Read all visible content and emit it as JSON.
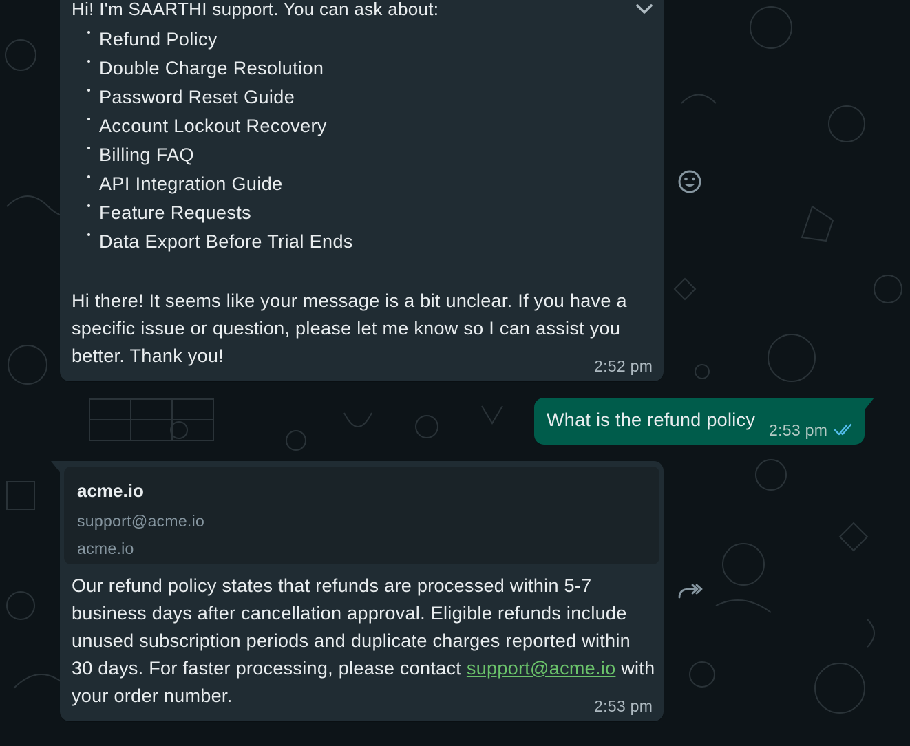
{
  "colors": {
    "incoming_bubble": "#202c33",
    "outgoing_bubble": "#005c4b",
    "timestamp": "#aebac1",
    "read_ticks": "#53bdeb",
    "link": "#6bc36b"
  },
  "messages": {
    "bot_intro": {
      "greeting": "Hi! I'm SAARTHI support. You can ask about:",
      "topics": [
        "Refund Policy",
        "Double Charge Resolution",
        "Password Reset Guide",
        "Account Lockout Recovery",
        "Billing FAQ",
        "API Integration Guide",
        "Feature Requests",
        "Data Export Before Trial Ends"
      ],
      "reply": "Hi there! It seems like your message is a bit unclear. If you have a specific issue or question, please let me know so I can assist you better. Thank you!",
      "time": "2:52 pm",
      "menu_icon": "chevron-down-icon"
    },
    "user_question": {
      "text": "What is the refund policy",
      "time": "2:53 pm",
      "status_icon": "double-check-icon"
    },
    "bot_answer": {
      "card": {
        "title": "acme.io",
        "line1": "support@acme.io",
        "line2": "acme.io"
      },
      "text_before_link": "Our refund policy states that refunds are processed within 5-7 business days after cancellation approval. Eligible refunds include unused subscription periods and duplicate charges reported within 30 days. For faster processing, please contact ",
      "link_text": "support@acme.io",
      "text_after_link": " with your order number.",
      "time": "2:53 pm"
    }
  },
  "actions": {
    "react_icon": "emoji-icon",
    "forward_icon": "forward-icon"
  }
}
